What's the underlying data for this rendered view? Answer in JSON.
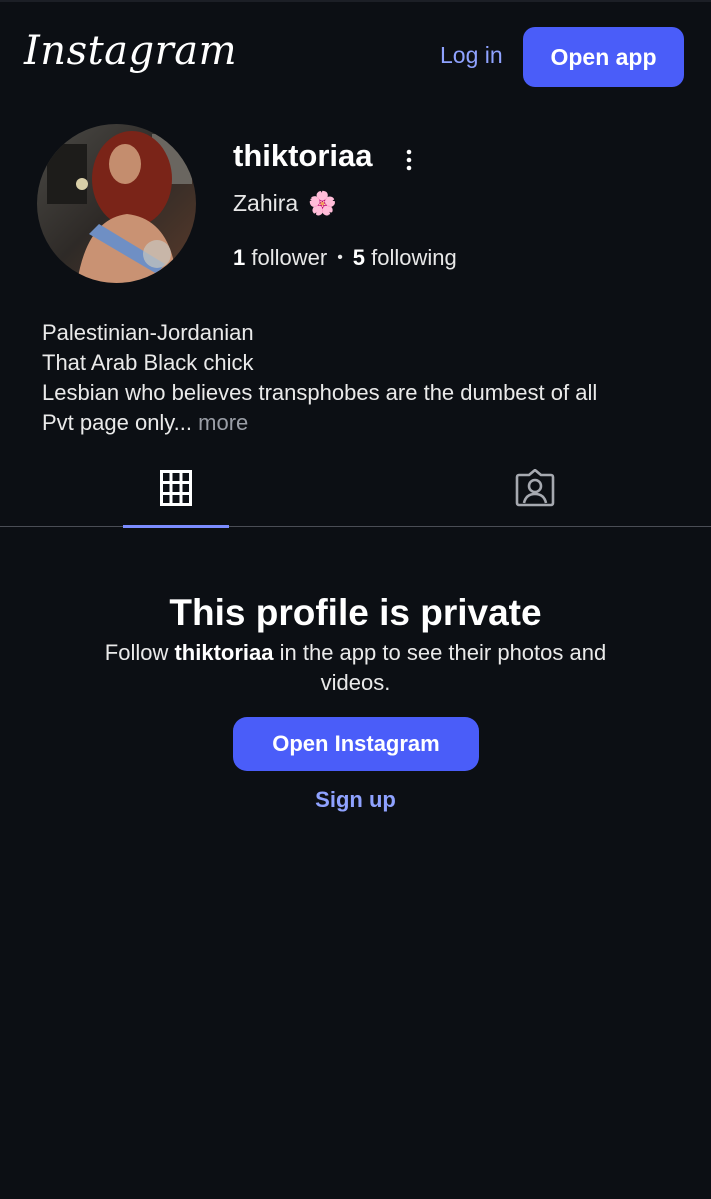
{
  "header": {
    "logo_text": "Instagram",
    "login_label": "Log in",
    "open_app_label": "Open app"
  },
  "profile": {
    "username": "thiktoriaa",
    "full_name": "Zahira",
    "full_name_emoji": "🌸",
    "followers_count": "1",
    "followers_label": "follower",
    "following_count": "5",
    "following_label": "following",
    "bio_lines": [
      "Palestinian-Jordanian",
      "That Arab Black chick",
      "Lesbian who believes transphobes are the dumbest of all",
      "Pvt page only..."
    ],
    "bio_more_label": "more"
  },
  "tabs": {
    "items": [
      {
        "icon": "grid-icon",
        "active": true
      },
      {
        "icon": "tagged-icon",
        "active": false
      }
    ]
  },
  "private": {
    "title": "This profile is private",
    "desc_prefix": "Follow ",
    "desc_username": "thiktoriaa",
    "desc_suffix": " in the app to see their photos and videos.",
    "open_instagram_label": "Open Instagram",
    "signup_label": "Sign up"
  },
  "colors": {
    "background": "#0c0f14",
    "accent": "#4a5df9",
    "link": "#8fa2ff"
  }
}
